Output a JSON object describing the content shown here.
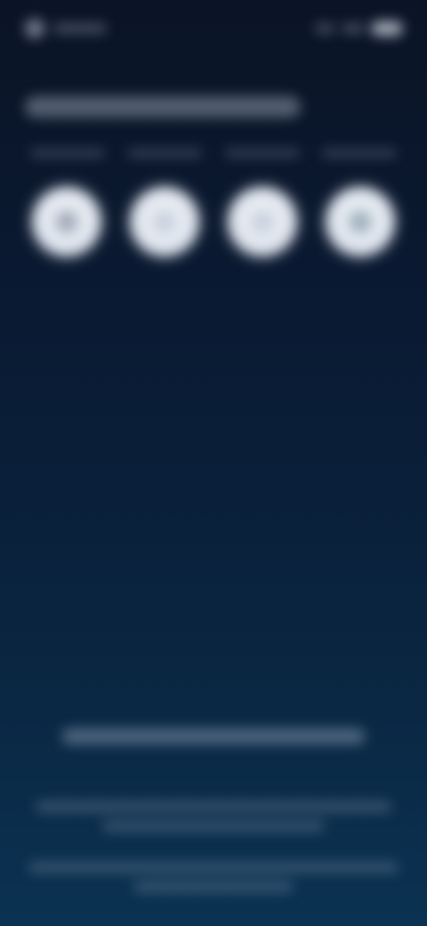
{
  "status_bar": {
    "time": "",
    "signal": "",
    "battery": ""
  },
  "header": {
    "title": ""
  },
  "quick_actions": [
    {
      "label": "",
      "icon": "gear-icon"
    },
    {
      "label": "",
      "icon": "circle-icon"
    },
    {
      "label": "",
      "icon": "circle-icon"
    },
    {
      "label": "",
      "icon": "check-icon"
    }
  ],
  "footer": {
    "primary_text": "",
    "secondary_text_1": "",
    "secondary_text_2": ""
  },
  "colors": {
    "background_top": "#0b1426",
    "background_bottom": "#0b3252",
    "button_face": "#dfe5ee"
  }
}
